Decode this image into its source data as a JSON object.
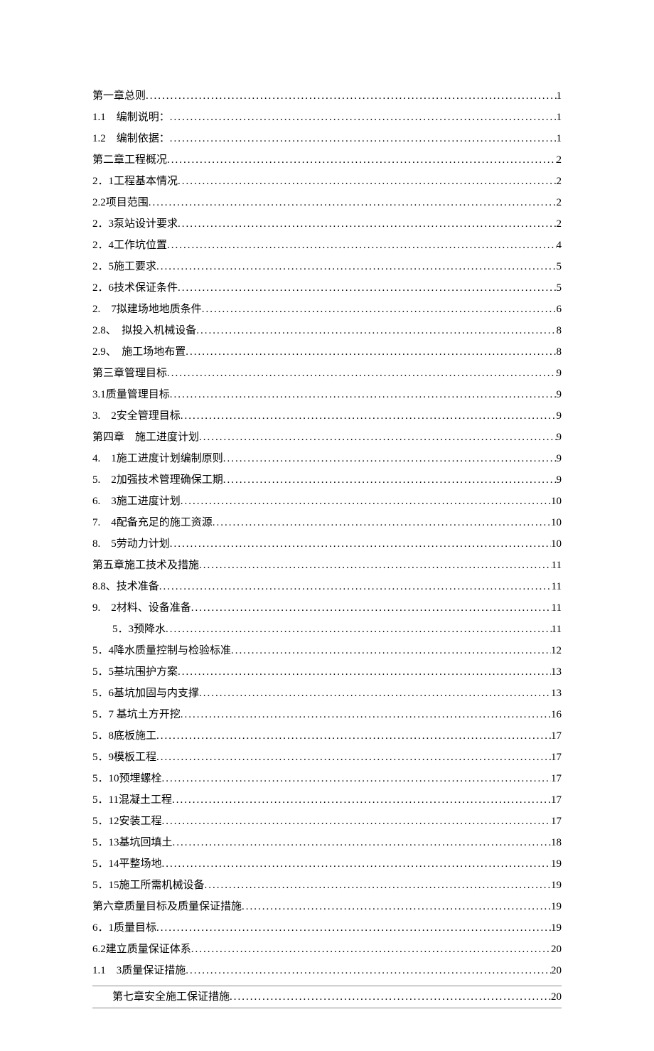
{
  "toc": [
    {
      "label": "第一章总则",
      "page": "1",
      "indent": 0
    },
    {
      "label": "1.1　编制说明：",
      "page": "1",
      "indent": 0
    },
    {
      "label": "1.2　编制依据：",
      "page": "1",
      "indent": 0
    },
    {
      "label": "第二章工程概况",
      "page": "2",
      "indent": 0
    },
    {
      "label": "2．1工程基本情况",
      "page": "2",
      "indent": 0
    },
    {
      "label": "2.2项目范围",
      "page": "2",
      "indent": 0
    },
    {
      "label": "2．3泵站设计要求",
      "page": "2",
      "indent": 0
    },
    {
      "label": "2．4工作坑位置",
      "page": "4",
      "indent": 0
    },
    {
      "label": "2．5施工要求",
      "page": "5",
      "indent": 0
    },
    {
      "label": "2．6技术保证条件",
      "page": "5",
      "indent": 0
    },
    {
      "label": "2.　7拟建场地地质条件",
      "page": "6",
      "indent": 0
    },
    {
      "label": "2.8、　拟投入机械设备",
      "page": "8",
      "indent": 0
    },
    {
      "label": "2.9、　施工场地布置",
      "page": "8",
      "indent": 0
    },
    {
      "label": "第三章管理目标",
      "page": "9",
      "indent": 0
    },
    {
      "label": "3.1质量管理目标",
      "page": "9",
      "indent": 0
    },
    {
      "label": "3.　2安全管理目标",
      "page": "9",
      "indent": 0
    },
    {
      "label": "第四章　施工进度计划",
      "page": "9",
      "indent": 0
    },
    {
      "label": "4.　1施工进度计划编制原则",
      "page": "9",
      "indent": 0
    },
    {
      "label": "5.　2加强技术管理确保工期",
      "page": "9",
      "indent": 0
    },
    {
      "label": "6.　3施工进度计划",
      "page": "10",
      "indent": 0
    },
    {
      "label": "7.　4配备充足的施工资源",
      "page": "10",
      "indent": 0
    },
    {
      "label": "8.　5劳动力计划",
      "page": "10",
      "indent": 0
    },
    {
      "label": "第五章施工技术及措施",
      "page": "11",
      "indent": 0
    },
    {
      "label": "8.8、技术准备",
      "page": "11",
      "indent": 0
    },
    {
      "label": "9.　2材料、设备准备",
      "page": "11",
      "indent": 0
    },
    {
      "label": "5．3预降水",
      "page": "11",
      "indent": 1
    },
    {
      "label": "5．4降水质量控制与检验标准",
      "page": "12",
      "indent": 0
    },
    {
      "label": "5．5基坑围护方案",
      "page": "13",
      "indent": 0
    },
    {
      "label": "5．6基坑加固与内支撑",
      "page": " 13",
      "indent": 0
    },
    {
      "label": "5．7 基坑土方开挖",
      "page": " 16",
      "indent": 0
    },
    {
      "label": "5．8底板施工",
      "page": "17",
      "indent": 0
    },
    {
      "label": "5．9模板工程",
      "page": "17",
      "indent": 0
    },
    {
      "label": "5．10预埋螺栓",
      "page": "17",
      "indent": 0
    },
    {
      "label": "5．11混凝土工程",
      "page": "17",
      "indent": 0
    },
    {
      "label": "5．12安装工程",
      "page": "17",
      "indent": 0
    },
    {
      "label": "5．13基坑回填土",
      "page": " 18",
      "indent": 0
    },
    {
      "label": "5．14平整场地",
      "page": "19",
      "indent": 0
    },
    {
      "label": "5．15施工所需机械设备",
      "page": "19",
      "indent": 0
    },
    {
      "label": "第六章质量目标及质量保证措施",
      "page": "19",
      "indent": 0
    },
    {
      "label": "6．1质量目标",
      "page": "19",
      "indent": 0
    },
    {
      "label": "6.2建立质量保证体系",
      "page": "20",
      "indent": 0
    },
    {
      "label": "1.1　3质量保证措施",
      "page": "20",
      "indent": 0
    }
  ],
  "ruled": [
    {
      "label": "第七章安全施工保证措施",
      "page": "20"
    }
  ]
}
